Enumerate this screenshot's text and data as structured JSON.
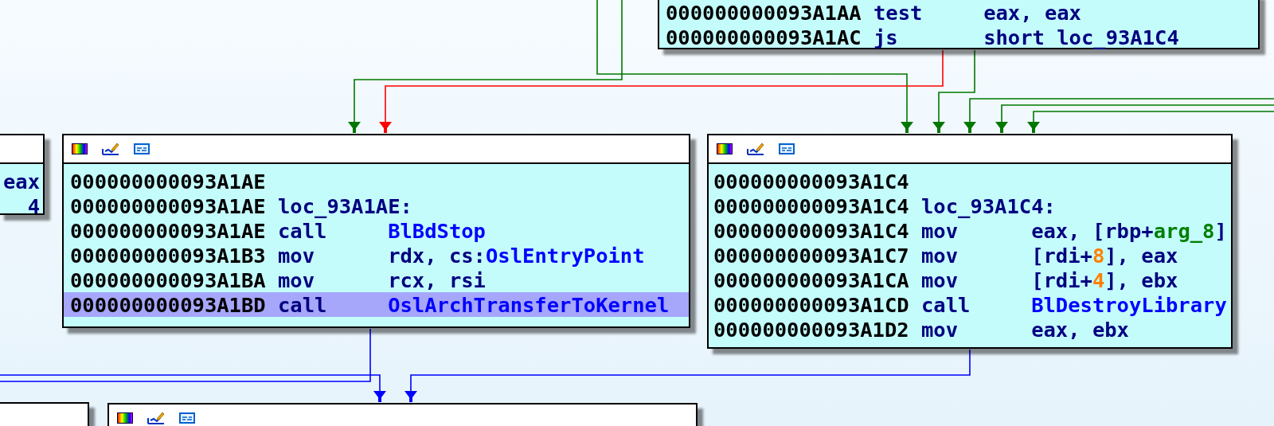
{
  "nodes": [
    {
      "header": false,
      "lines": [
        {
          "address": "000000000093A1AA",
          "mnemonic": "test",
          "operands": [
            {
              "text": "eax, eax",
              "kind": "plain"
            }
          ],
          "selected": false
        },
        {
          "address": "000000000093A1AC",
          "mnemonic": "js",
          "operands": [
            {
              "text": "short loc_93A1C4",
              "kind": "plain"
            }
          ],
          "selected": false
        }
      ]
    },
    {
      "header": true,
      "lines": [
        {
          "operands": [
            {
              "text": "eax",
              "kind": "plain"
            }
          ],
          "selected": false
        },
        {
          "operands": [
            {
              "text": "4",
              "kind": "plain"
            }
          ],
          "selected": false
        }
      ]
    },
    {
      "header": true,
      "lines": [
        {
          "address": "000000000093A1AE",
          "selected": false
        },
        {
          "address": "000000000093A1AE",
          "label": "loc_93A1AE:",
          "selected": false
        },
        {
          "address": "000000000093A1AE",
          "mnemonic": "call",
          "operands": [
            {
              "text": "BlBdStop",
              "kind": "name"
            }
          ],
          "selected": false
        },
        {
          "address": "000000000093A1B3",
          "mnemonic": "mov",
          "operands": [
            {
              "text": "rdx, cs:",
              "kind": "plain"
            },
            {
              "text": "OslEntryPoint",
              "kind": "name"
            }
          ],
          "selected": false
        },
        {
          "address": "000000000093A1BA",
          "mnemonic": "mov",
          "operands": [
            {
              "text": "rcx, rsi",
              "kind": "plain"
            }
          ],
          "selected": false
        },
        {
          "address": "000000000093A1BD",
          "mnemonic": "call",
          "operands": [
            {
              "text": "OslArchTransferToKernel",
              "kind": "name"
            }
          ],
          "selected": true
        }
      ]
    },
    {
      "header": true,
      "lines": [
        {
          "address": "000000000093A1C4",
          "selected": false
        },
        {
          "address": "000000000093A1C4",
          "label": "loc_93A1C4:",
          "selected": false
        },
        {
          "address": "000000000093A1C4",
          "mnemonic": "mov",
          "operands": [
            {
              "text": "eax, [rbp+",
              "kind": "plain"
            },
            {
              "text": "arg_8",
              "kind": "arg"
            },
            {
              "text": "]",
              "kind": "plain"
            }
          ],
          "selected": false
        },
        {
          "address": "000000000093A1C7",
          "mnemonic": "mov",
          "operands": [
            {
              "text": "[rdi+",
              "kind": "plain"
            },
            {
              "text": "8",
              "kind": "number"
            },
            {
              "text": "], eax",
              "kind": "plain"
            }
          ],
          "selected": false
        },
        {
          "address": "000000000093A1CA",
          "mnemonic": "mov",
          "operands": [
            {
              "text": "[rdi+",
              "kind": "plain"
            },
            {
              "text": "4",
              "kind": "number"
            },
            {
              "text": "], ebx",
              "kind": "plain"
            }
          ],
          "selected": false
        },
        {
          "address": "000000000093A1CD",
          "mnemonic": "call",
          "operands": [
            {
              "text": "BlDestroyLibrary",
              "kind": "name"
            }
          ],
          "selected": false
        },
        {
          "address": "000000000093A1D2",
          "mnemonic": "mov",
          "operands": [
            {
              "text": "eax, ebx",
              "kind": "plain"
            }
          ],
          "selected": false
        }
      ]
    },
    {
      "header": true
    },
    {
      "header": true
    }
  ]
}
